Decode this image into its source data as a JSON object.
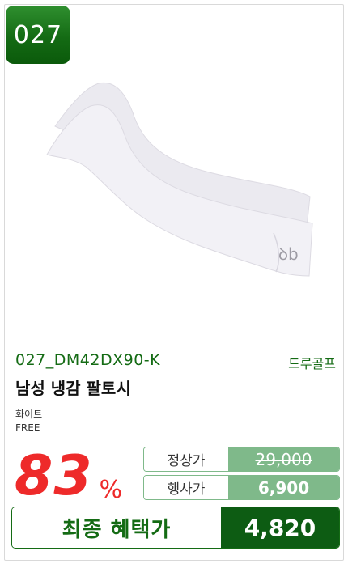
{
  "badge": {
    "rank": "027"
  },
  "product": {
    "code": "027_DM42DX90-K",
    "brand": "드루골프",
    "name": "남성 냉감 팔토시",
    "color": "화이트",
    "size": "FREE",
    "image": {
      "subject": "arm-sleeve",
      "color": "#f1f0f4",
      "logo": "ꝺ"
    }
  },
  "pricing": {
    "discount_number": "83",
    "discount_unit": "%",
    "regular_label": "정상가",
    "regular_price": "29,000",
    "sale_label": "행사가",
    "sale_price": "6,900",
    "final_label": "최종 혜택가",
    "final_price": "4,820"
  },
  "colors": {
    "brand_green": "#146b14",
    "dark_green": "#0d5c13",
    "light_green": "#7fb98a",
    "discount_red": "#ee2a2a"
  }
}
